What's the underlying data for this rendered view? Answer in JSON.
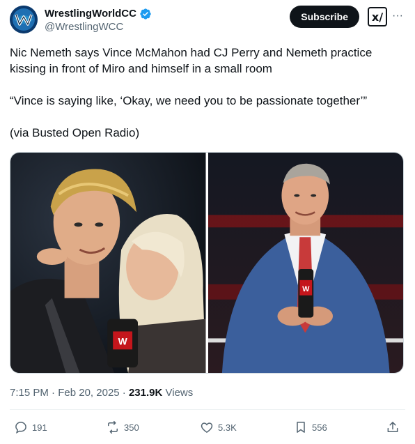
{
  "author": {
    "display_name": "WrestlingWorldCC",
    "handle": "@WrestlingWCC"
  },
  "header": {
    "subscribe_label": "Subscribe",
    "grok_label": "x/",
    "more_label": "···"
  },
  "tweet": {
    "text": "Nic Nemeth says Vince McMahon had CJ Perry and Nemeth practice kissing in front of Miro and himself in a small room\n\n“Vince is saying like, ‘Okay, we need you to be passionate together’”\n\n(via Busted Open Radio)",
    "time": "7:15 PM",
    "date": "Feb 20, 2025",
    "views_count": "231.9K",
    "views_label": "Views"
  },
  "actions": {
    "replies": "191",
    "reposts": "350",
    "likes": "5.3K",
    "bookmarks": "556"
  },
  "colors": {
    "verified": "#1d9bf0",
    "subscribe_bg": "#0f1419",
    "secondary_text": "#536471"
  }
}
